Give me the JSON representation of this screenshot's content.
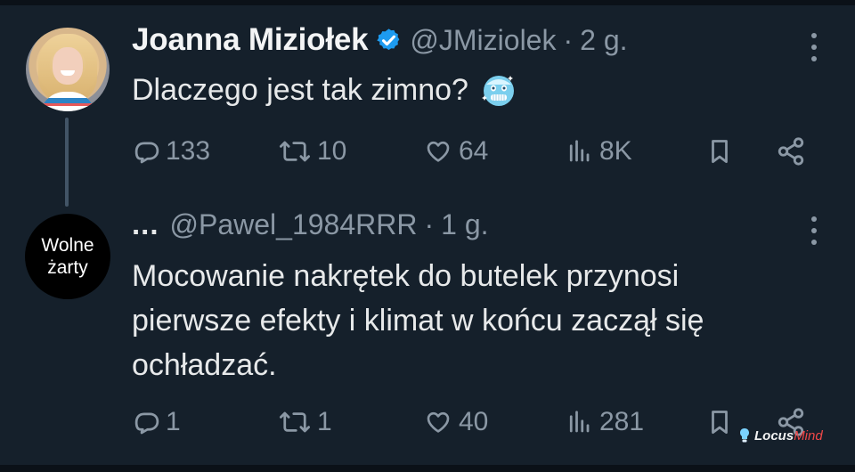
{
  "tweets": [
    {
      "display_name": "Joanna Miziołek",
      "handle": "@JMiziolek",
      "separator": "·",
      "time": "2 g.",
      "text": "Dlaczego jest tak zimno?",
      "emoji_icon": "cold-face-icon",
      "actions": {
        "replies": "133",
        "retweets": "10",
        "likes": "64",
        "views": "8K"
      }
    },
    {
      "display_name_prefix": "...",
      "avatar_text": [
        "Wolne",
        "żarty"
      ],
      "handle": "@Pawel_1984RRR",
      "separator": "·",
      "time": "1 g.",
      "text": "Mocowanie nakrętek do butelek przynosi\npierwsze efekty i klimat w końcu zaczął się\nochładzać.",
      "actions": {
        "replies": "1",
        "retweets": "1",
        "likes": "40",
        "views": "281"
      }
    }
  ],
  "watermark": {
    "part1": "Locus",
    "part2": "Mind"
  },
  "colors": {
    "background": "#15202b",
    "text": "#e7e9ea",
    "muted": "#8b98a5",
    "verified": "#1d9bf0",
    "thread_line": "#425466"
  },
  "icons": [
    "verified-badge-icon",
    "more-options-icon",
    "reply-icon",
    "retweet-icon",
    "like-icon",
    "views-icon",
    "bookmark-icon",
    "share-icon",
    "cold-face-icon",
    "light-bulb-icon"
  ]
}
